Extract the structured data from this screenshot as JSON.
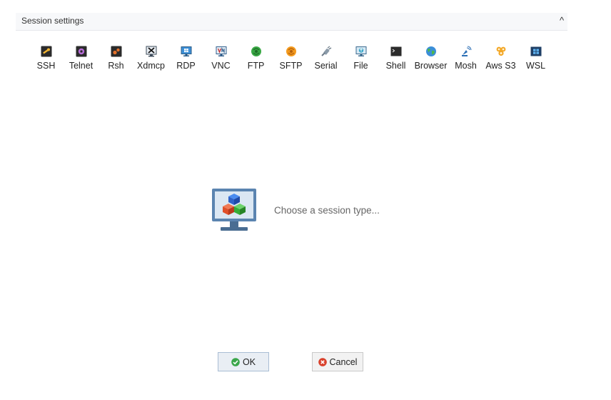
{
  "window": {
    "title": "Session settings",
    "collapse_glyph": "^"
  },
  "session_types": [
    {
      "label": "SSH",
      "icon": "ssh-icon"
    },
    {
      "label": "Telnet",
      "icon": "telnet-icon"
    },
    {
      "label": "Rsh",
      "icon": "rsh-icon"
    },
    {
      "label": "Xdmcp",
      "icon": "xdmcp-icon"
    },
    {
      "label": "RDP",
      "icon": "rdp-icon"
    },
    {
      "label": "VNC",
      "icon": "vnc-icon"
    },
    {
      "label": "FTP",
      "icon": "ftp-icon"
    },
    {
      "label": "SFTP",
      "icon": "sftp-icon"
    },
    {
      "label": "Serial",
      "icon": "serial-icon"
    },
    {
      "label": "File",
      "icon": "file-icon"
    },
    {
      "label": "Shell",
      "icon": "shell-icon"
    },
    {
      "label": "Browser",
      "icon": "browser-icon"
    },
    {
      "label": "Mosh",
      "icon": "mosh-icon"
    },
    {
      "label": "Aws S3",
      "icon": "aws-s3-icon"
    },
    {
      "label": "WSL",
      "icon": "wsl-icon"
    }
  ],
  "main": {
    "message": "Choose a session type..."
  },
  "buttons": {
    "ok_label": "OK",
    "cancel_label": "Cancel"
  },
  "colors": {
    "accent_green": "#3aa64a",
    "cancel_red": "#d9402b"
  }
}
